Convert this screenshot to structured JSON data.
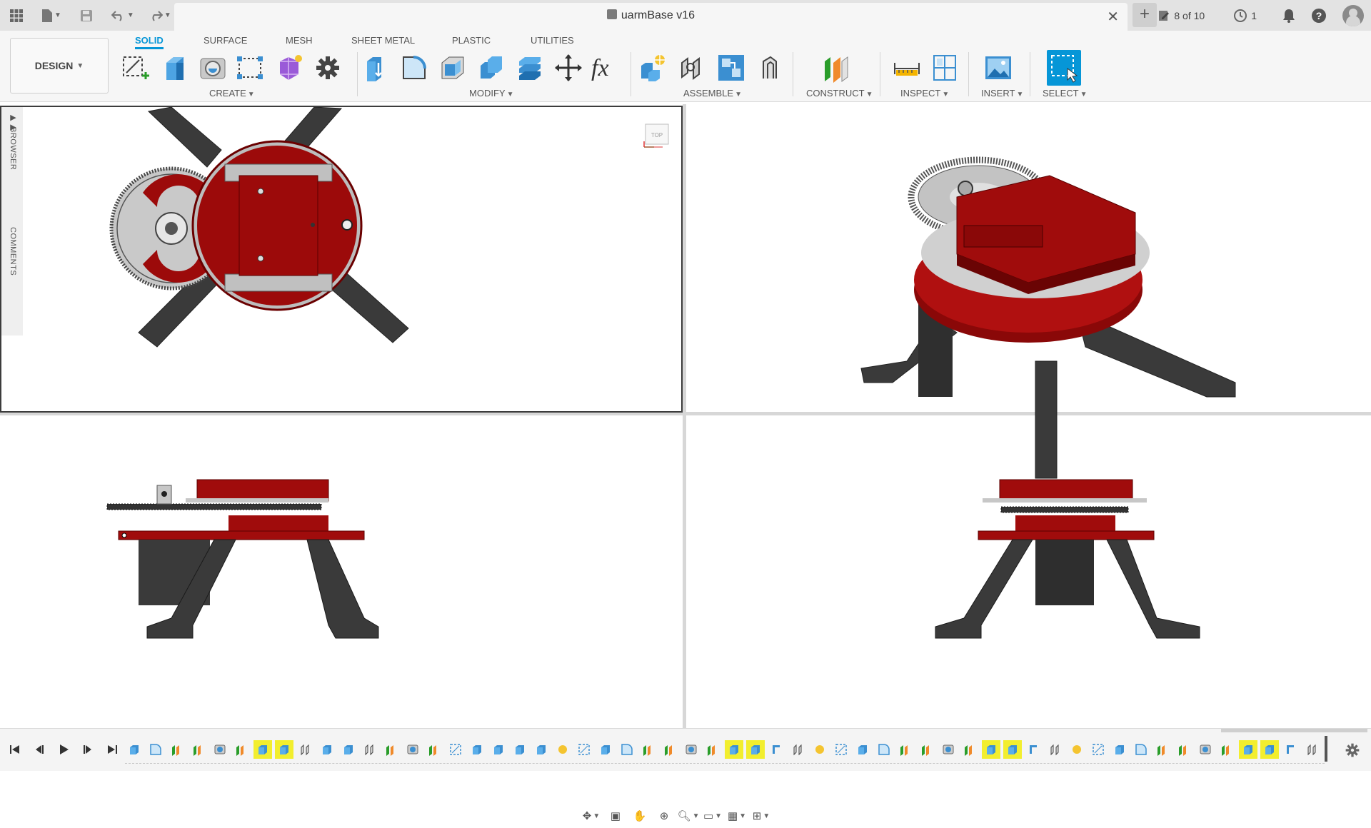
{
  "titlebar": {
    "document_title": "uarmBase v16",
    "version_count": "8 of 10",
    "jobs_count": "1"
  },
  "toolbar": {
    "workspace": "DESIGN",
    "tabs": [
      "SOLID",
      "SURFACE",
      "MESH",
      "SHEET METAL",
      "PLASTIC",
      "UTILITIES"
    ],
    "active_tab": "SOLID",
    "groups": [
      "CREATE",
      "MODIFY",
      "ASSEMBLE",
      "CONSTRUCT",
      "INSPECT",
      "INSERT",
      "SELECT"
    ]
  },
  "browser": {
    "browser_label": "BROWSER",
    "comments_label": "COMMENTS"
  },
  "viewcube": {
    "label": "TOP"
  },
  "colors": {
    "accent": "#0696d7",
    "part_red": "#9c0a0a",
    "gear_grey": "#c7c7c7",
    "leg_dark": "#3a3a3a",
    "timeline_highlight": "#f2ee2e"
  },
  "timeline": {
    "items": [
      "extrude",
      "fillet",
      "plane",
      "plane",
      "hole",
      "plane",
      "extrude-hl",
      "extrude-hl",
      "joint",
      "extrude",
      "extrude",
      "joint",
      "plane",
      "hole",
      "plane",
      "sketch",
      "extrude",
      "extrude",
      "extrude",
      "extrude",
      "component",
      "sketch",
      "extrude",
      "fillet",
      "plane",
      "plane",
      "hole",
      "plane",
      "extrude-hl",
      "extrude-hl",
      "rigid",
      "joint",
      "component",
      "sketch",
      "extrude",
      "fillet",
      "plane",
      "plane",
      "hole",
      "plane",
      "extrude-hl",
      "extrude-hl",
      "rigid",
      "joint",
      "component",
      "sketch",
      "extrude",
      "fillet",
      "plane",
      "plane",
      "hole",
      "plane",
      "extrude-hl",
      "extrude-hl",
      "rigid",
      "joint"
    ]
  }
}
